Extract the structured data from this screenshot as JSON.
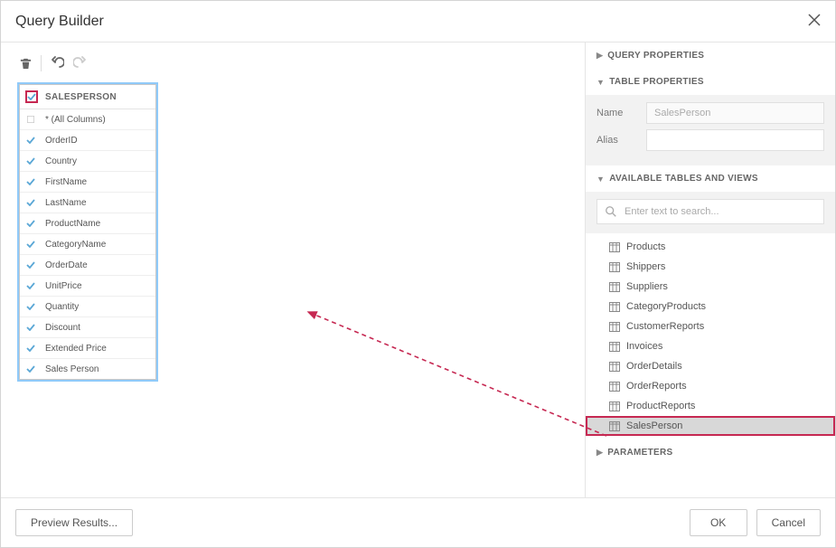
{
  "title": "Query Builder",
  "table_card": {
    "name": "SALESPERSON",
    "columns": [
      {
        "label": "* (All Columns)",
        "checked": false
      },
      {
        "label": "OrderID",
        "checked": true
      },
      {
        "label": "Country",
        "checked": true
      },
      {
        "label": "FirstName",
        "checked": true
      },
      {
        "label": "LastName",
        "checked": true
      },
      {
        "label": "ProductName",
        "checked": true
      },
      {
        "label": "CategoryName",
        "checked": true
      },
      {
        "label": "OrderDate",
        "checked": true
      },
      {
        "label": "UnitPrice",
        "checked": true
      },
      {
        "label": "Quantity",
        "checked": true
      },
      {
        "label": "Discount",
        "checked": true
      },
      {
        "label": "Extended Price",
        "checked": true
      },
      {
        "label": "Sales Person",
        "checked": true
      }
    ]
  },
  "right": {
    "query_props": "QUERY PROPERTIES",
    "table_props": "TABLE PROPERTIES",
    "name_label": "Name",
    "name_value": "SalesPerson",
    "alias_label": "Alias",
    "alias_value": "",
    "available_header": "AVAILABLE TABLES AND VIEWS",
    "search_placeholder": "Enter text to search...",
    "tables": [
      {
        "label": "Products",
        "selected": false
      },
      {
        "label": "Shippers",
        "selected": false
      },
      {
        "label": "Suppliers",
        "selected": false
      },
      {
        "label": "CategoryProducts",
        "selected": false
      },
      {
        "label": "CustomerReports",
        "selected": false
      },
      {
        "label": "Invoices",
        "selected": false
      },
      {
        "label": "OrderDetails",
        "selected": false
      },
      {
        "label": "OrderReports",
        "selected": false
      },
      {
        "label": "ProductReports",
        "selected": false
      },
      {
        "label": "SalesPerson",
        "selected": true
      }
    ],
    "parameters_header": "PARAMETERS"
  },
  "footer": {
    "preview": "Preview Results...",
    "ok": "OK",
    "cancel": "Cancel"
  },
  "colors": {
    "highlight": "#c62852",
    "select_outline": "#90caf9",
    "check_blue": "#5aa7d6"
  }
}
